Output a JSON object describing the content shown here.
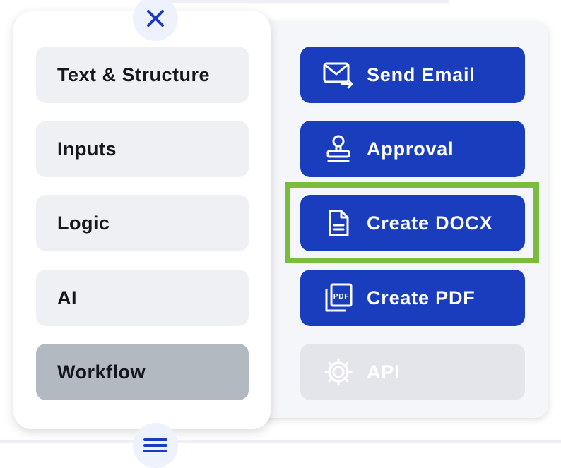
{
  "categories": [
    {
      "label": "Text & Structure",
      "active": false
    },
    {
      "label": "Inputs",
      "active": false
    },
    {
      "label": "Logic",
      "active": false
    },
    {
      "label": "AI",
      "active": false
    },
    {
      "label": "Workflow",
      "active": true
    }
  ],
  "actions": [
    {
      "label": "Send Email",
      "icon": "send-email-icon",
      "enabled": true
    },
    {
      "label": "Approval",
      "icon": "approval-stamp-icon",
      "enabled": true
    },
    {
      "label": "Create DOCX",
      "icon": "document-icon",
      "enabled": true,
      "highlighted": true
    },
    {
      "label": "Create PDF",
      "icon": "pdf-icon",
      "enabled": true
    },
    {
      "label": "API",
      "icon": "gear-icon",
      "enabled": false
    }
  ],
  "controls": {
    "close_icon": "close-icon",
    "menu_icon": "hamburger-menu-icon"
  },
  "colors": {
    "primary": "#1a3dbe",
    "highlight": "#7cbc3c",
    "active_category": "#b3b9c0",
    "disabled": "#e3e5ea"
  }
}
